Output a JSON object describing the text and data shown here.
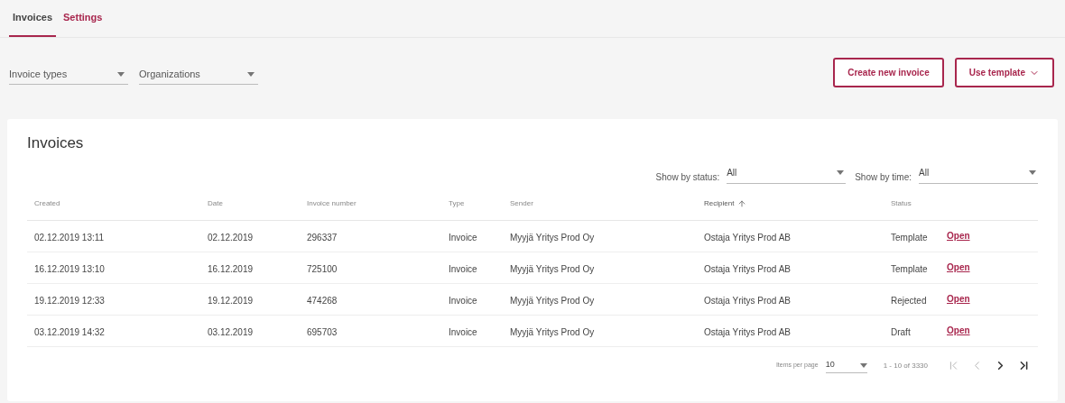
{
  "tabs": [
    {
      "label": "Invoices",
      "selected": true
    },
    {
      "label": "Settings",
      "selected": false
    }
  ],
  "filters": [
    {
      "label": "Invoice types"
    },
    {
      "label": "Organizations"
    }
  ],
  "actions": {
    "create": "Create new invoice",
    "template": "Use template"
  },
  "card": {
    "title": "Invoices",
    "status_filter": {
      "label": "Show by status:",
      "value": "All"
    },
    "time_filter": {
      "label": "Show by time:",
      "value": "All"
    },
    "table": {
      "columns": [
        {
          "label": "Created",
          "sorted": false
        },
        {
          "label": "Date",
          "sorted": false
        },
        {
          "label": "Invoice number",
          "sorted": false
        },
        {
          "label": "Type",
          "sorted": false
        },
        {
          "label": "Sender",
          "sorted": false
        },
        {
          "label": "Recipient",
          "sorted": true
        },
        {
          "label": "Status",
          "sorted": false
        }
      ],
      "rows": [
        {
          "cells": [
            "02.12.2019 13:11",
            "02.12.2019",
            "296337",
            "Invoice",
            "Myyjä Yritys Prod Oy",
            "Ostaja Yritys Prod AB",
            "Template"
          ],
          "link": "Open"
        },
        {
          "cells": [
            "16.12.2019 13:10",
            "16.12.2019",
            "725100",
            "Invoice",
            "Myyjä Yritys Prod Oy",
            "Ostaja Yritys Prod AB",
            "Template"
          ],
          "link": "Open"
        },
        {
          "cells": [
            "19.12.2019 12:33",
            "19.12.2019",
            "474268",
            "Invoice",
            "Myyjä Yritys Prod Oy",
            "Ostaja Yritys Prod AB",
            "Rejected"
          ],
          "link": "Open"
        },
        {
          "cells": [
            "03.12.2019 14:32",
            "03.12.2019",
            "695703",
            "Invoice",
            "Myyjä Yritys Prod Oy",
            "Ostaja Yritys Prod AB",
            "Draft"
          ],
          "link": "Open"
        }
      ]
    },
    "paginator": {
      "items_label": "Items per page",
      "page_size": "10",
      "range": "1 - 10 of 3330",
      "buttons": [
        {
          "kind": "first",
          "disabled": true
        },
        {
          "kind": "prev",
          "disabled": true
        },
        {
          "kind": "next",
          "disabled": false
        },
        {
          "kind": "last",
          "disabled": false
        }
      ]
    }
  }
}
